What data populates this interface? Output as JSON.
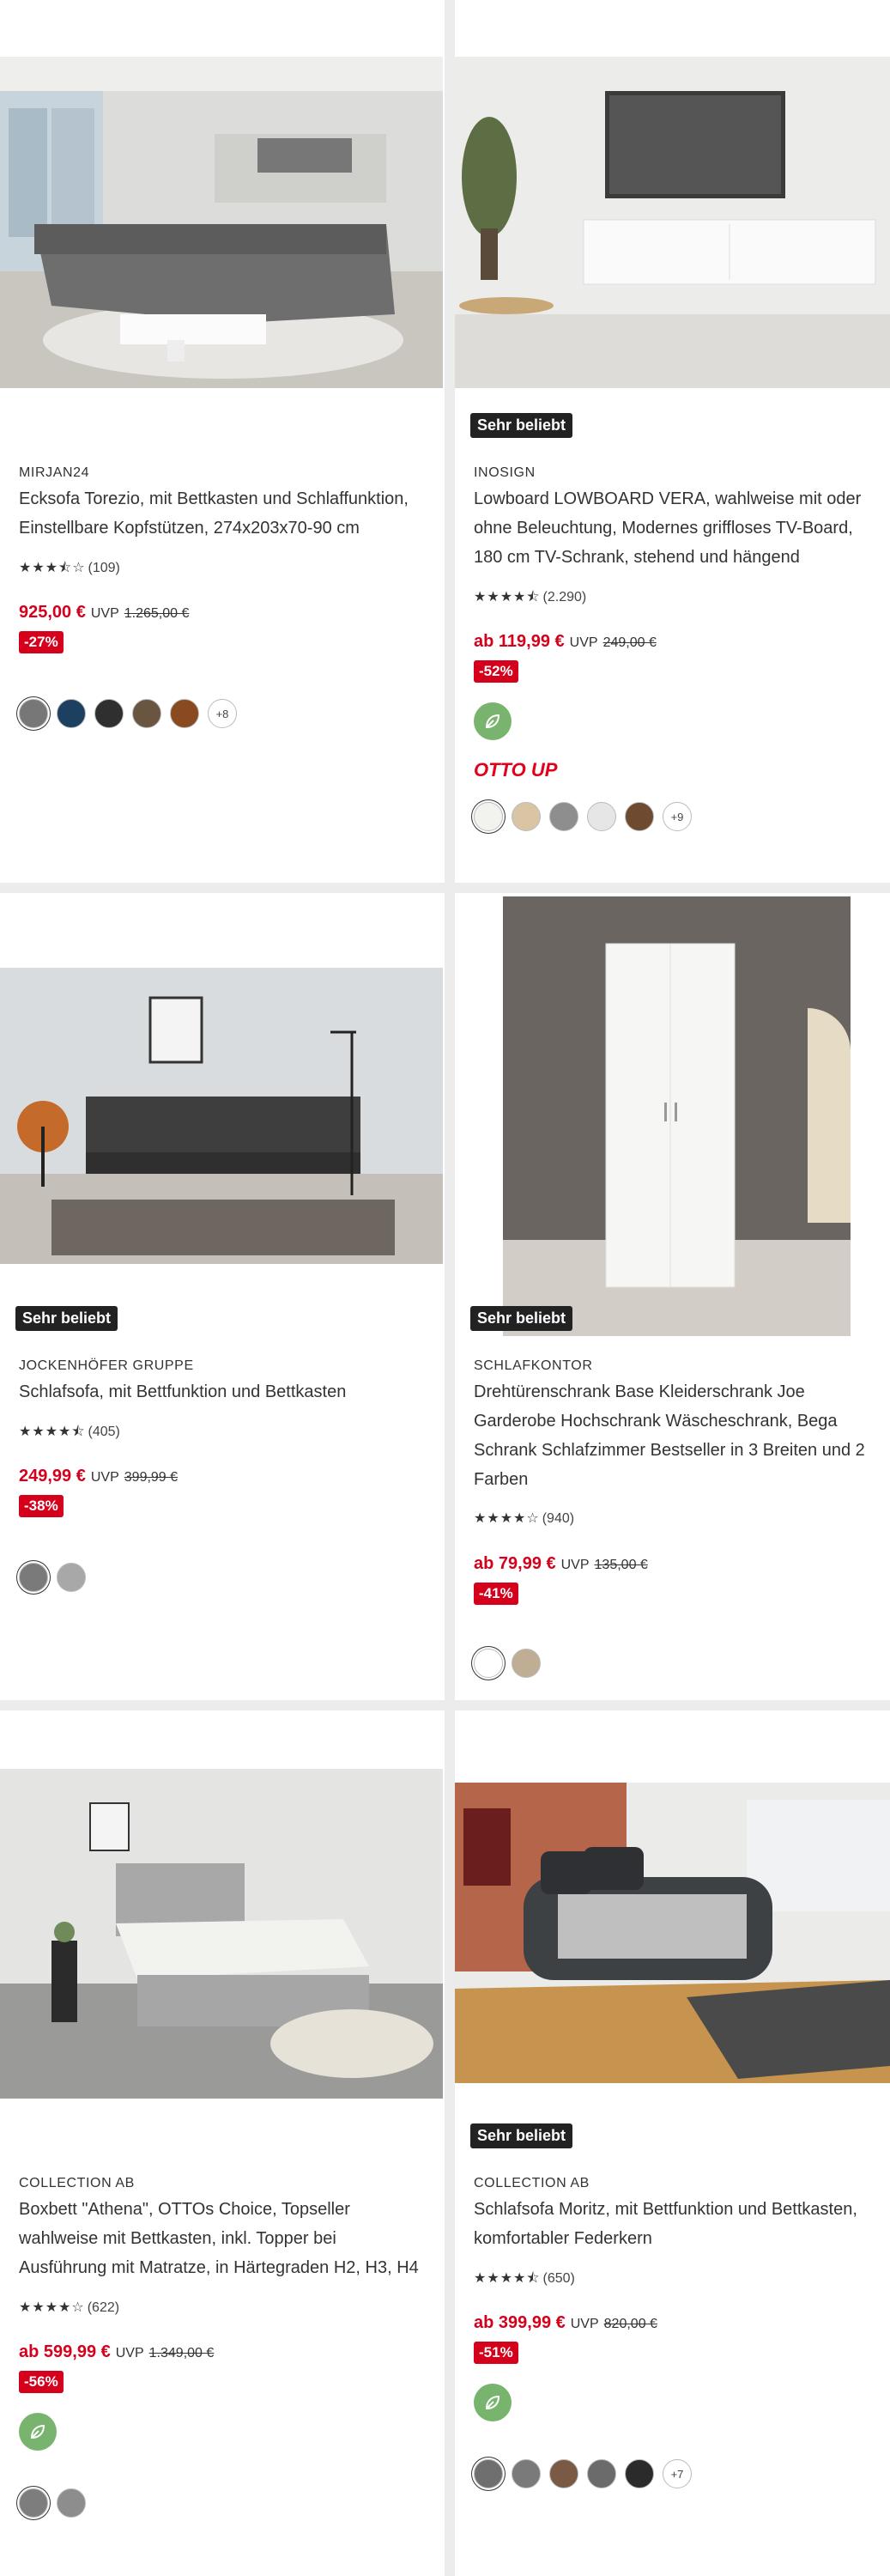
{
  "products": [
    {
      "brand": "MIRJAN24",
      "title_lines": [
        "Ecksofa Torezio, mit Bettkasten und Schlaffunktion,",
        "Einstellbare Kopfstützen, 274x203x70-90 cm"
      ],
      "rating": 3.5,
      "reviews": "(109)",
      "price": "925,00 €",
      "uvp_label": "UVP",
      "old_price": "1.265,00 €",
      "discount": "-27%",
      "swatches": [
        "#777777",
        "#1e4060",
        "#2f2f2f",
        "#6a5640",
        "#8a4a20"
      ],
      "more": "+8"
    },
    {
      "badge": "Sehr beliebt",
      "brand": "INOSIGN",
      "title_lines": [
        "Lowboard LOWBOARD VERA, wahlweise mit oder",
        "ohne Beleuchtung, Modernes griffloses TV-Board,",
        "180 cm TV-Schrank, stehend und hängend"
      ],
      "rating": 4.5,
      "reviews": "(2.290)",
      "price": "ab 119,99 €",
      "uvp_label": "UVP",
      "old_price": "249,00 €",
      "discount": "-52%",
      "eco_icon": "leaf-icon",
      "otto_up": "OTTO UP",
      "swatches": [
        "#f2f2ee",
        "#d9c4a3",
        "#8e8e8e",
        "#e6e6e6",
        "#6e4a30"
      ],
      "more": "+9"
    },
    {
      "badge": "Sehr beliebt",
      "brand": "JOCKENHÖFER GRUPPE",
      "title_lines": [
        "Schlafsofa, mit Bettfunktion und Bettkasten"
      ],
      "rating": 4.5,
      "reviews": "(405)",
      "price": "249,99 €",
      "uvp_label": "UVP",
      "old_price": "399,99 €",
      "discount": "-38%",
      "swatches": [
        "#7a7a7a",
        "#a8a8a8"
      ]
    },
    {
      "badge": "Sehr beliebt",
      "brand": "SCHLAFKONTOR",
      "title_lines": [
        "Drehtürenschrank Base Kleiderschrank Joe",
        "Garderobe Hochschrank Wäscheschrank, Bega",
        "Schrank Schlafzimmer Bestseller in 3 Breiten und 2",
        "Farben"
      ],
      "rating": 4,
      "reviews": "(940)",
      "price": "ab 79,99 €",
      "uvp_label": "UVP",
      "old_price": "135,00 €",
      "discount": "-41%",
      "swatches": [
        "#ffffff",
        "#bfae94"
      ]
    },
    {
      "brand": "COLLECTION AB",
      "title_lines": [
        "Boxbett \"Athena\", OTTOs Choice, Topseller",
        "wahlweise mit Bettkasten, inkl. Topper bei",
        "Ausführung mit Matratze, in Härtegraden H2, H3, H4"
      ],
      "rating": 4,
      "reviews": "(622)",
      "price": "ab 599,99 €",
      "uvp_label": "UVP",
      "old_price": "1.349,00 €",
      "discount": "-56%",
      "eco_icon": "leaf-icon",
      "swatches": [
        "#7d7d7d",
        "#8d8d8d"
      ]
    },
    {
      "badge": "Sehr beliebt",
      "brand": "COLLECTION AB",
      "title_lines": [
        "Schlafsofa Moritz, mit Bettfunktion und Bettkasten,",
        "komfortabler Federkern"
      ],
      "rating": 4.5,
      "reviews": "(650)",
      "price": "ab 399,99 €",
      "uvp_label": "UVP",
      "old_price": "820,00 €",
      "discount": "-51%",
      "eco_icon": "leaf-icon",
      "swatches": [
        "#6f6f6f",
        "#7a7a7a",
        "#7a5a44",
        "#6b6b6b",
        "#2b2b2b"
      ],
      "more": "+7"
    }
  ],
  "colors": {
    "price": "#d4001c",
    "badge": "#222222",
    "eco": "#79b46f"
  }
}
